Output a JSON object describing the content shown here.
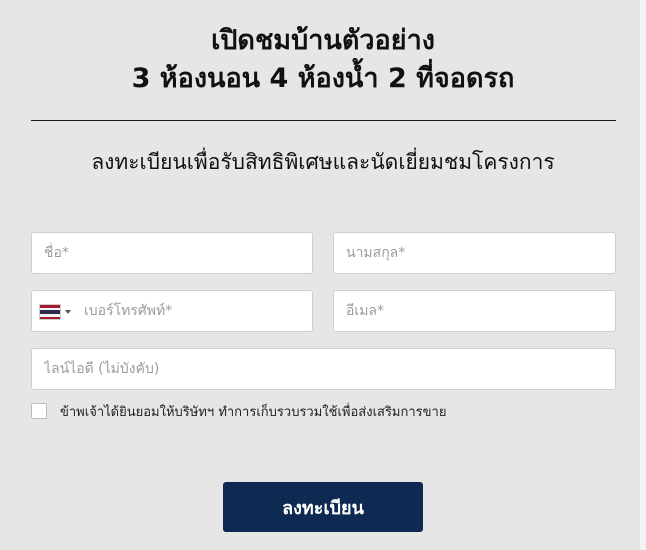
{
  "headline": {
    "line1": "เปิดชมบ้านตัวอย่าง",
    "line2": "3 ห้องนอน 4 ห้องน้ำ 2 ที่จอดรถ"
  },
  "subheadline": "ลงทะเบียนเพื่อรับสิทธิพิเศษและนัดเยี่ยมชมโครงการ",
  "form": {
    "first_name": {
      "placeholder": "ชื่อ*",
      "value": ""
    },
    "last_name": {
      "placeholder": "นามสกุล*",
      "value": ""
    },
    "phone": {
      "placeholder": "เบอร์โทรศัพท์*",
      "value": "",
      "country_icon": "thailand-flag-icon",
      "flag_colors": [
        "#a51931",
        "#f4f5f8",
        "#2d2a4a",
        "#f4f5f8",
        "#a51931"
      ]
    },
    "email": {
      "placeholder": "อีเมล*",
      "value": ""
    },
    "line_id": {
      "placeholder": "ไลน์ไอดี (ไม่บังคับ)",
      "value": ""
    },
    "consent_label": "ข้าพเจ้าได้ยินยอมให้บริษัทฯ ทำการเก็บรวบรวมใช้เพื่อส่งเสริมการขาย",
    "consent_checked": false,
    "submit_label": "ลงทะเบียน"
  },
  "colors": {
    "background": "#e6e6e6",
    "button": "#0e2a52",
    "text": "#111111"
  }
}
